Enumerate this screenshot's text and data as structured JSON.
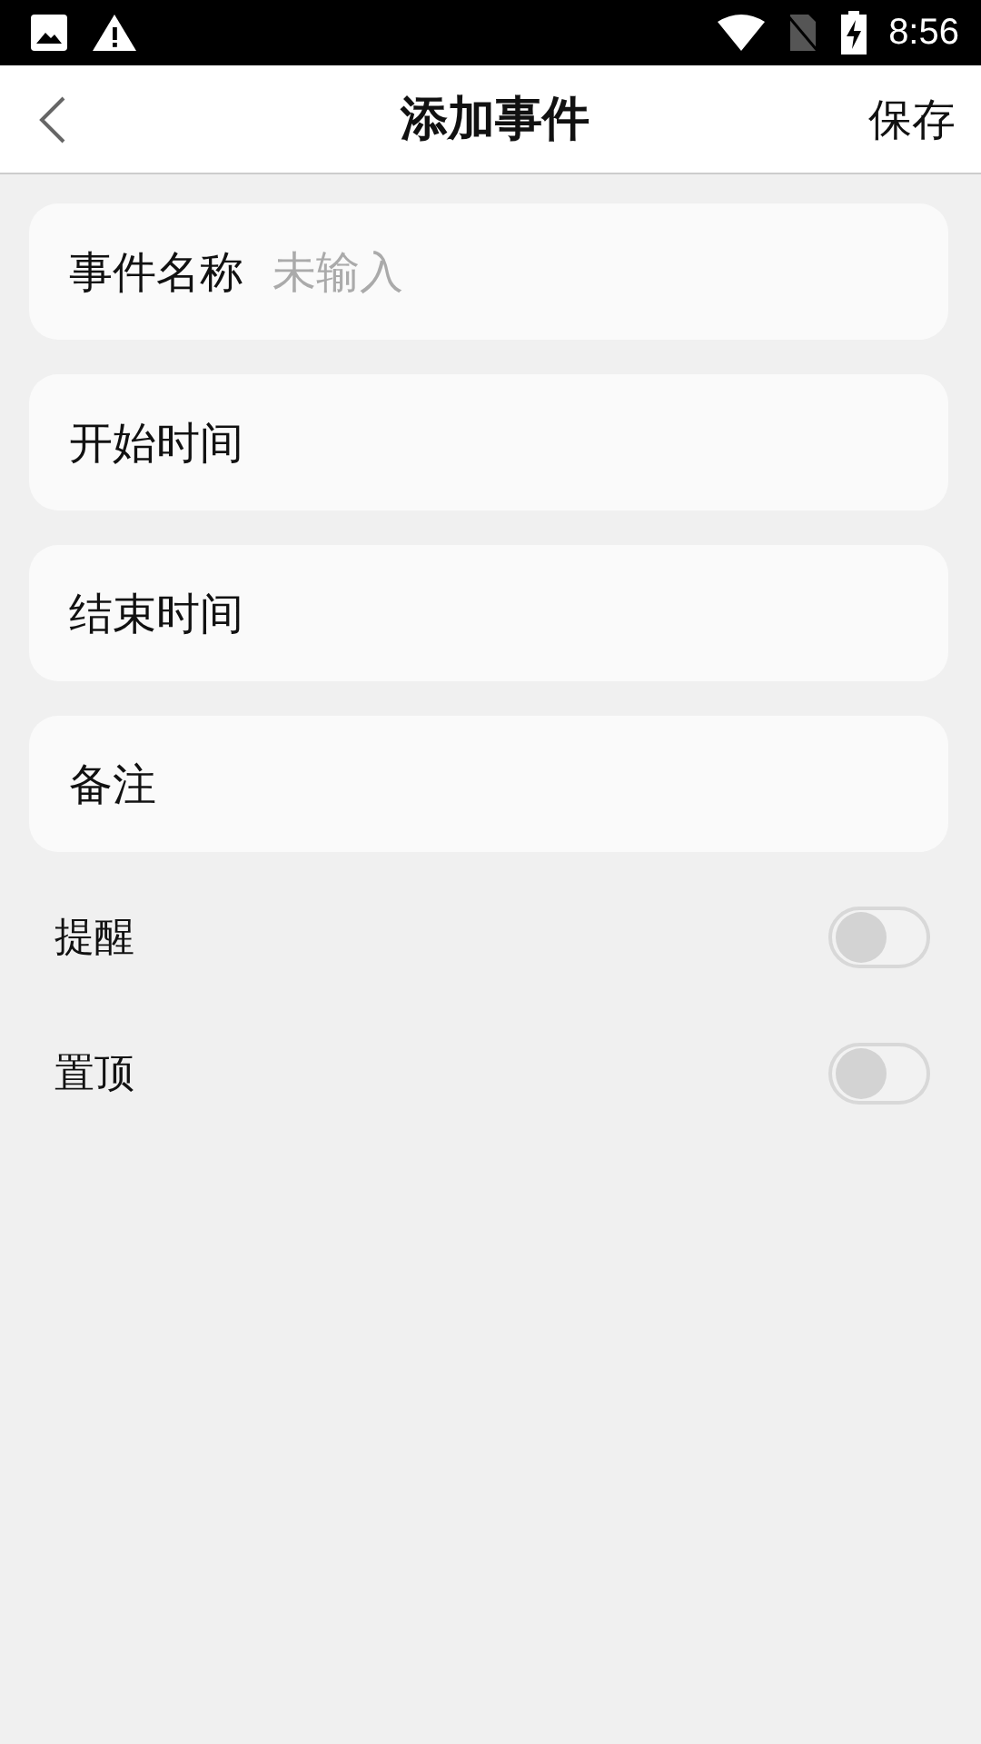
{
  "status_bar": {
    "time": "8:56"
  },
  "header": {
    "title": "添加事件",
    "action": "保存"
  },
  "fields": [
    {
      "kind": "input",
      "label": "事件名称",
      "placeholder": "未输入"
    },
    {
      "kind": "picker",
      "label": "开始时间"
    },
    {
      "kind": "picker",
      "label": "结束时间"
    },
    {
      "kind": "picker",
      "label": "备注"
    }
  ],
  "switches": [
    {
      "label": "提醒",
      "on": false
    },
    {
      "label": "置顶",
      "on": false
    }
  ]
}
